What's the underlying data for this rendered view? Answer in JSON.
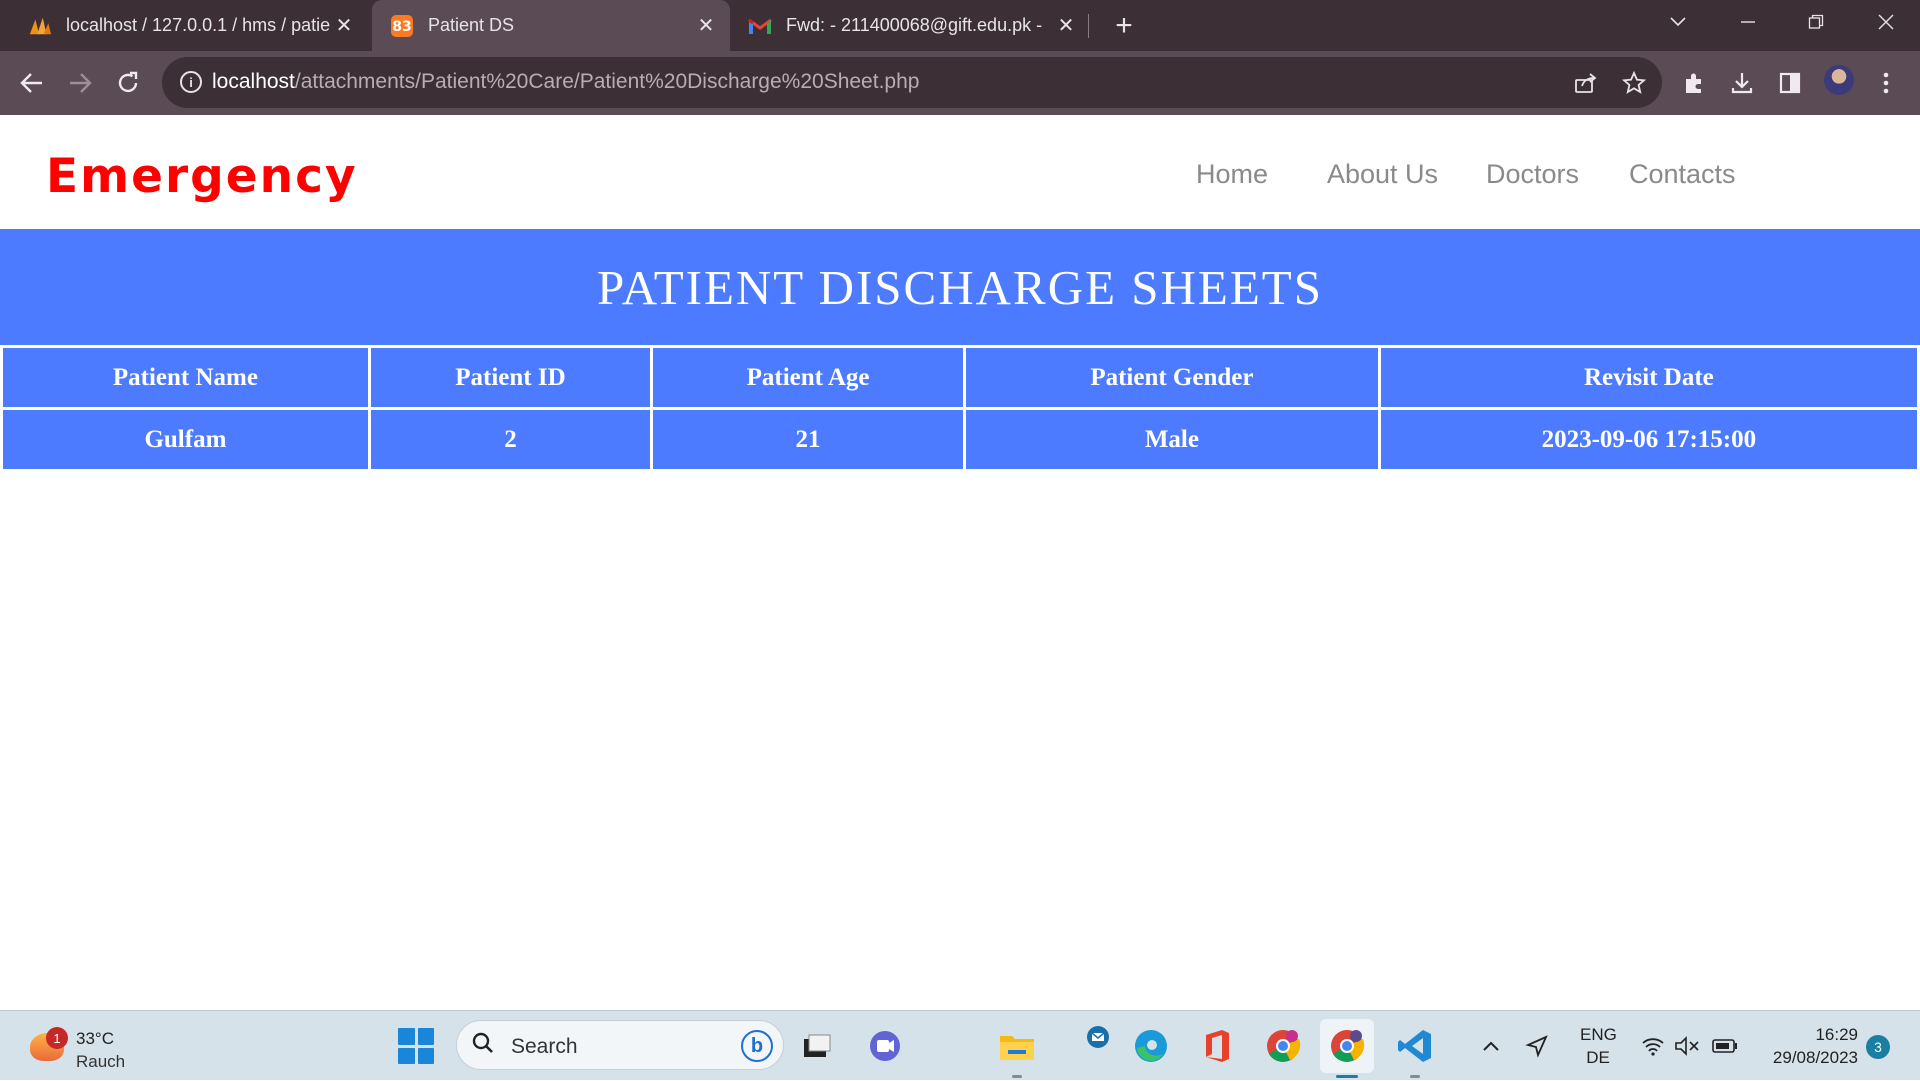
{
  "browser": {
    "tabs": [
      {
        "title": "localhost / 127.0.0.1 / hms / patie",
        "icon": "phpmyadmin-icon",
        "active": false
      },
      {
        "title": "Patient DS",
        "icon": "xampp-icon",
        "active": true
      },
      {
        "title": "Fwd: - 211400068@gift.edu.pk - ",
        "icon": "gmail-icon",
        "active": false
      }
    ],
    "url_host": "localhost",
    "url_path": "/attachments/Patient%20Care/Patient%20Discharge%20Sheet.php"
  },
  "site": {
    "logo": "Emergency",
    "nav": [
      "Home",
      "About Us",
      "Doctors",
      "Contacts"
    ]
  },
  "page_title": "PATIENT DISCHARGE SHEETS",
  "table": {
    "headers": [
      "Patient Name",
      "Patient ID",
      "Patient Age",
      "Patient Gender",
      "Revisit Date"
    ],
    "rows": [
      [
        "Gulfam",
        "2",
        "21",
        "Male",
        "2023-09-06 17:15:00"
      ]
    ]
  },
  "taskbar": {
    "weather_temp": "33°C",
    "weather_cond": "Rauch",
    "weather_badge": "1",
    "search_label": "Search",
    "lang_top": "ENG",
    "lang_bottom": "DE",
    "time": "16:29",
    "date": "29/08/2023",
    "notifications": "3"
  },
  "colors": {
    "accent": "#4d7bff",
    "logo": "#ff0000",
    "tabbar": "#3c3036",
    "toolbar": "#5b4b54"
  }
}
